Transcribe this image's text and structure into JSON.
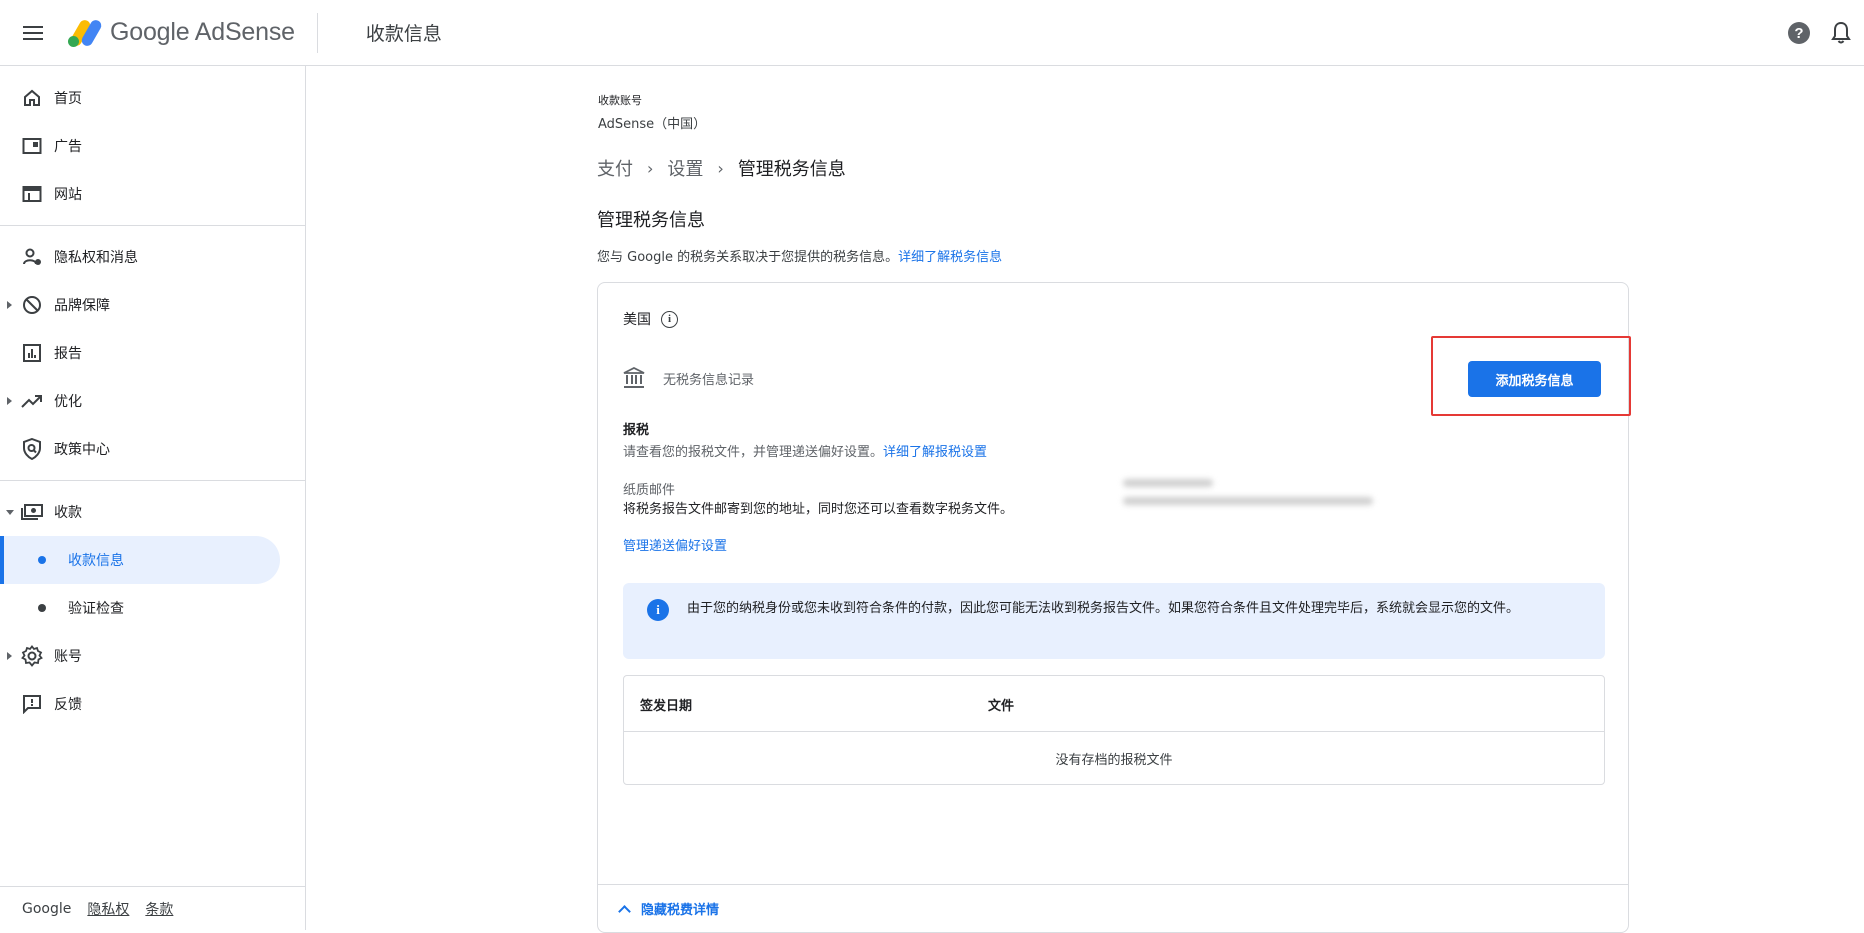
{
  "header": {
    "brand": "Google AdSense",
    "page_title": "收款信息"
  },
  "sidebar": {
    "items": [
      {
        "label": "首页",
        "icon": "home-icon"
      },
      {
        "label": "广告",
        "icon": "ads-icon"
      },
      {
        "label": "网站",
        "icon": "sites-icon"
      },
      {
        "label": "隐私权和消息",
        "icon": "privacy-icon"
      },
      {
        "label": "品牌保障",
        "icon": "block-icon"
      },
      {
        "label": "报告",
        "icon": "reports-icon"
      },
      {
        "label": "优化",
        "icon": "trending-icon"
      },
      {
        "label": "政策中心",
        "icon": "policy-icon"
      },
      {
        "label": "收款",
        "icon": "payments-icon"
      },
      {
        "label": "账号",
        "icon": "gear-icon"
      },
      {
        "label": "反馈",
        "icon": "feedback-icon"
      }
    ],
    "payments_sub": [
      {
        "label": "收款信息",
        "active": true
      },
      {
        "label": "验证检查",
        "active": false
      }
    ],
    "footer": {
      "google": "Google",
      "privacy": "隐私权",
      "terms": "条款"
    }
  },
  "main": {
    "account_label": "收款账号",
    "account_value": "AdSense（中国）",
    "breadcrumb": [
      "支付",
      "设置",
      "管理税务信息"
    ],
    "section_title": "管理税务信息",
    "section_desc": "您与 Google 的税务关系取决于您提供的税务信息。",
    "section_link": "详细了解税务信息",
    "card": {
      "country": "美国",
      "no_record": "无税务信息记录",
      "add_button": "添加税务信息",
      "tax_heading": "报税",
      "tax_desc": "请查看您的报税文件，并管理递送偏好设置。",
      "tax_link": "详细了解报税设置",
      "paper_label": "纸质邮件",
      "paper_desc": "将税务报告文件邮寄到您的地址，同时您还可以查看数字税务文件。",
      "manage_link": "管理递送偏好设置",
      "notice": "由于您的纳税身份或您未收到符合条件的付款，因此您可能无法收到税务报告文件。如果您符合条件且文件处理完毕后，系统就会显示您的文件。",
      "table": {
        "col_date": "签发日期",
        "col_file": "文件",
        "empty": "没有存档的报税文件"
      },
      "hide_details": "隐藏税费详情"
    }
  },
  "colors": {
    "accent": "#1a73e8",
    "highlight": "#e53935",
    "notice_bg": "#e8f0fe"
  }
}
